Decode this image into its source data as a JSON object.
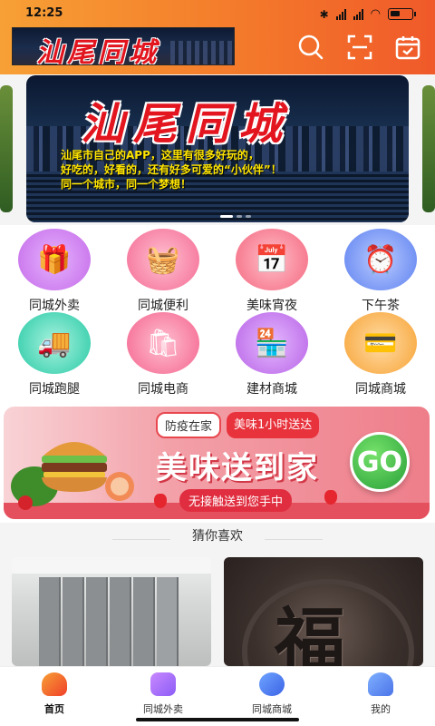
{
  "status_bar": {
    "time": "12:25"
  },
  "header": {
    "logo_text": "汕尾同城",
    "search_icon": "search-icon",
    "scan_icon": "scan-icon",
    "calendar_icon": "calendar-check-icon",
    "bg_colors": [
      "#f7a035",
      "#f0592a"
    ]
  },
  "banner": {
    "title": "汕尾同城",
    "slogan_line1": "汕尾市自己的APP，这里有很多好玩的，",
    "slogan_line2": "好吃的，好看的，还有好多可爱的“小伙伴”！",
    "slogan_line3": "同一个城市，同一个梦想！"
  },
  "categories": [
    {
      "label": "同城外卖",
      "icon": "gift-box-icon",
      "color": "#c46ae8"
    },
    {
      "label": "同城便利",
      "icon": "shopping-basket-icon",
      "color": "#f46a93"
    },
    {
      "label": "美味宵夜",
      "icon": "calendar-food-icon",
      "color": "#f4667f"
    },
    {
      "label": "下午茶",
      "icon": "alarm-clock-icon",
      "color": "#5b7ff0"
    },
    {
      "label": "同城跑腿",
      "icon": "delivery-truck-icon",
      "color": "#27c9a5"
    },
    {
      "label": "同城电商",
      "icon": "shopping-bag-icon",
      "color": "#f4638d"
    },
    {
      "label": "建材商城",
      "icon": "shop-store-icon",
      "color": "#b862e6"
    },
    {
      "label": "同城商城",
      "icon": "wallet-cards-icon",
      "color": "#f7a233"
    }
  ],
  "promo": {
    "tag1": "防疫在家",
    "tag2": "美味1小时送达",
    "headline": "美味送到家",
    "subline": "无接触送到您手中",
    "go_label": "GO"
  },
  "recommend": {
    "title": "猜你喜欢"
  },
  "bottom_nav": [
    {
      "label": "首页",
      "icon": "home-icon",
      "active": true
    },
    {
      "label": "同城外卖",
      "icon": "bag-icon",
      "active": false
    },
    {
      "label": "同城商城",
      "icon": "compass-icon",
      "active": false
    },
    {
      "label": "我的",
      "icon": "user-icon",
      "active": false
    }
  ]
}
